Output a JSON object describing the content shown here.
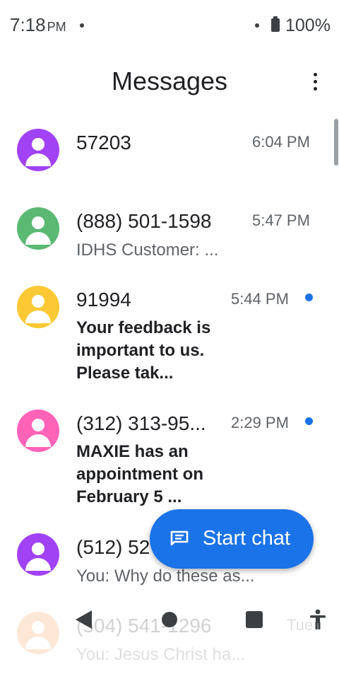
{
  "status_bar": {
    "time": "7:18",
    "ampm": "PM",
    "battery": "100%"
  },
  "app_bar": {
    "title": "Messages",
    "more_icon": "more-vert-icon"
  },
  "conversations": [
    {
      "name": "57203",
      "time": "6:04 PM",
      "snippet": "",
      "unread": false,
      "avatar_color": "#a142f4"
    },
    {
      "name": "(888) 501-1598",
      "time": "5:47 PM",
      "snippet": "IDHS Customer: ...",
      "unread": false,
      "avatar_color": "#5bb974"
    },
    {
      "name": "91994",
      "time": "5:44 PM",
      "snippet": "Your feedback is important to us. Please tak...",
      "unread": true,
      "avatar_color": "#fcc934"
    },
    {
      "name": "(312) 313-95...",
      "time": "2:29 PM",
      "snippet": "MAXIE has an appointment on February 5 ...",
      "unread": true,
      "avatar_color": "#ff63b8"
    },
    {
      "name": "(512) 52",
      "time": "",
      "snippet": "You: Why do these as...",
      "unread": false,
      "avatar_color": "#a142f4"
    },
    {
      "name": "(504) 541-1296",
      "time": "Tue",
      "snippet": "You: Jesus Christ ha...",
      "unread": false,
      "avatar_color": "#fa903e"
    }
  ],
  "fab": {
    "label": "Start chat",
    "icon": "chat-icon"
  },
  "nav": {
    "back": "back-icon",
    "home": "home-icon",
    "recents": "recents-icon",
    "accessibility": "accessibility-icon"
  },
  "colors": {
    "accent": "#1a73e8"
  }
}
